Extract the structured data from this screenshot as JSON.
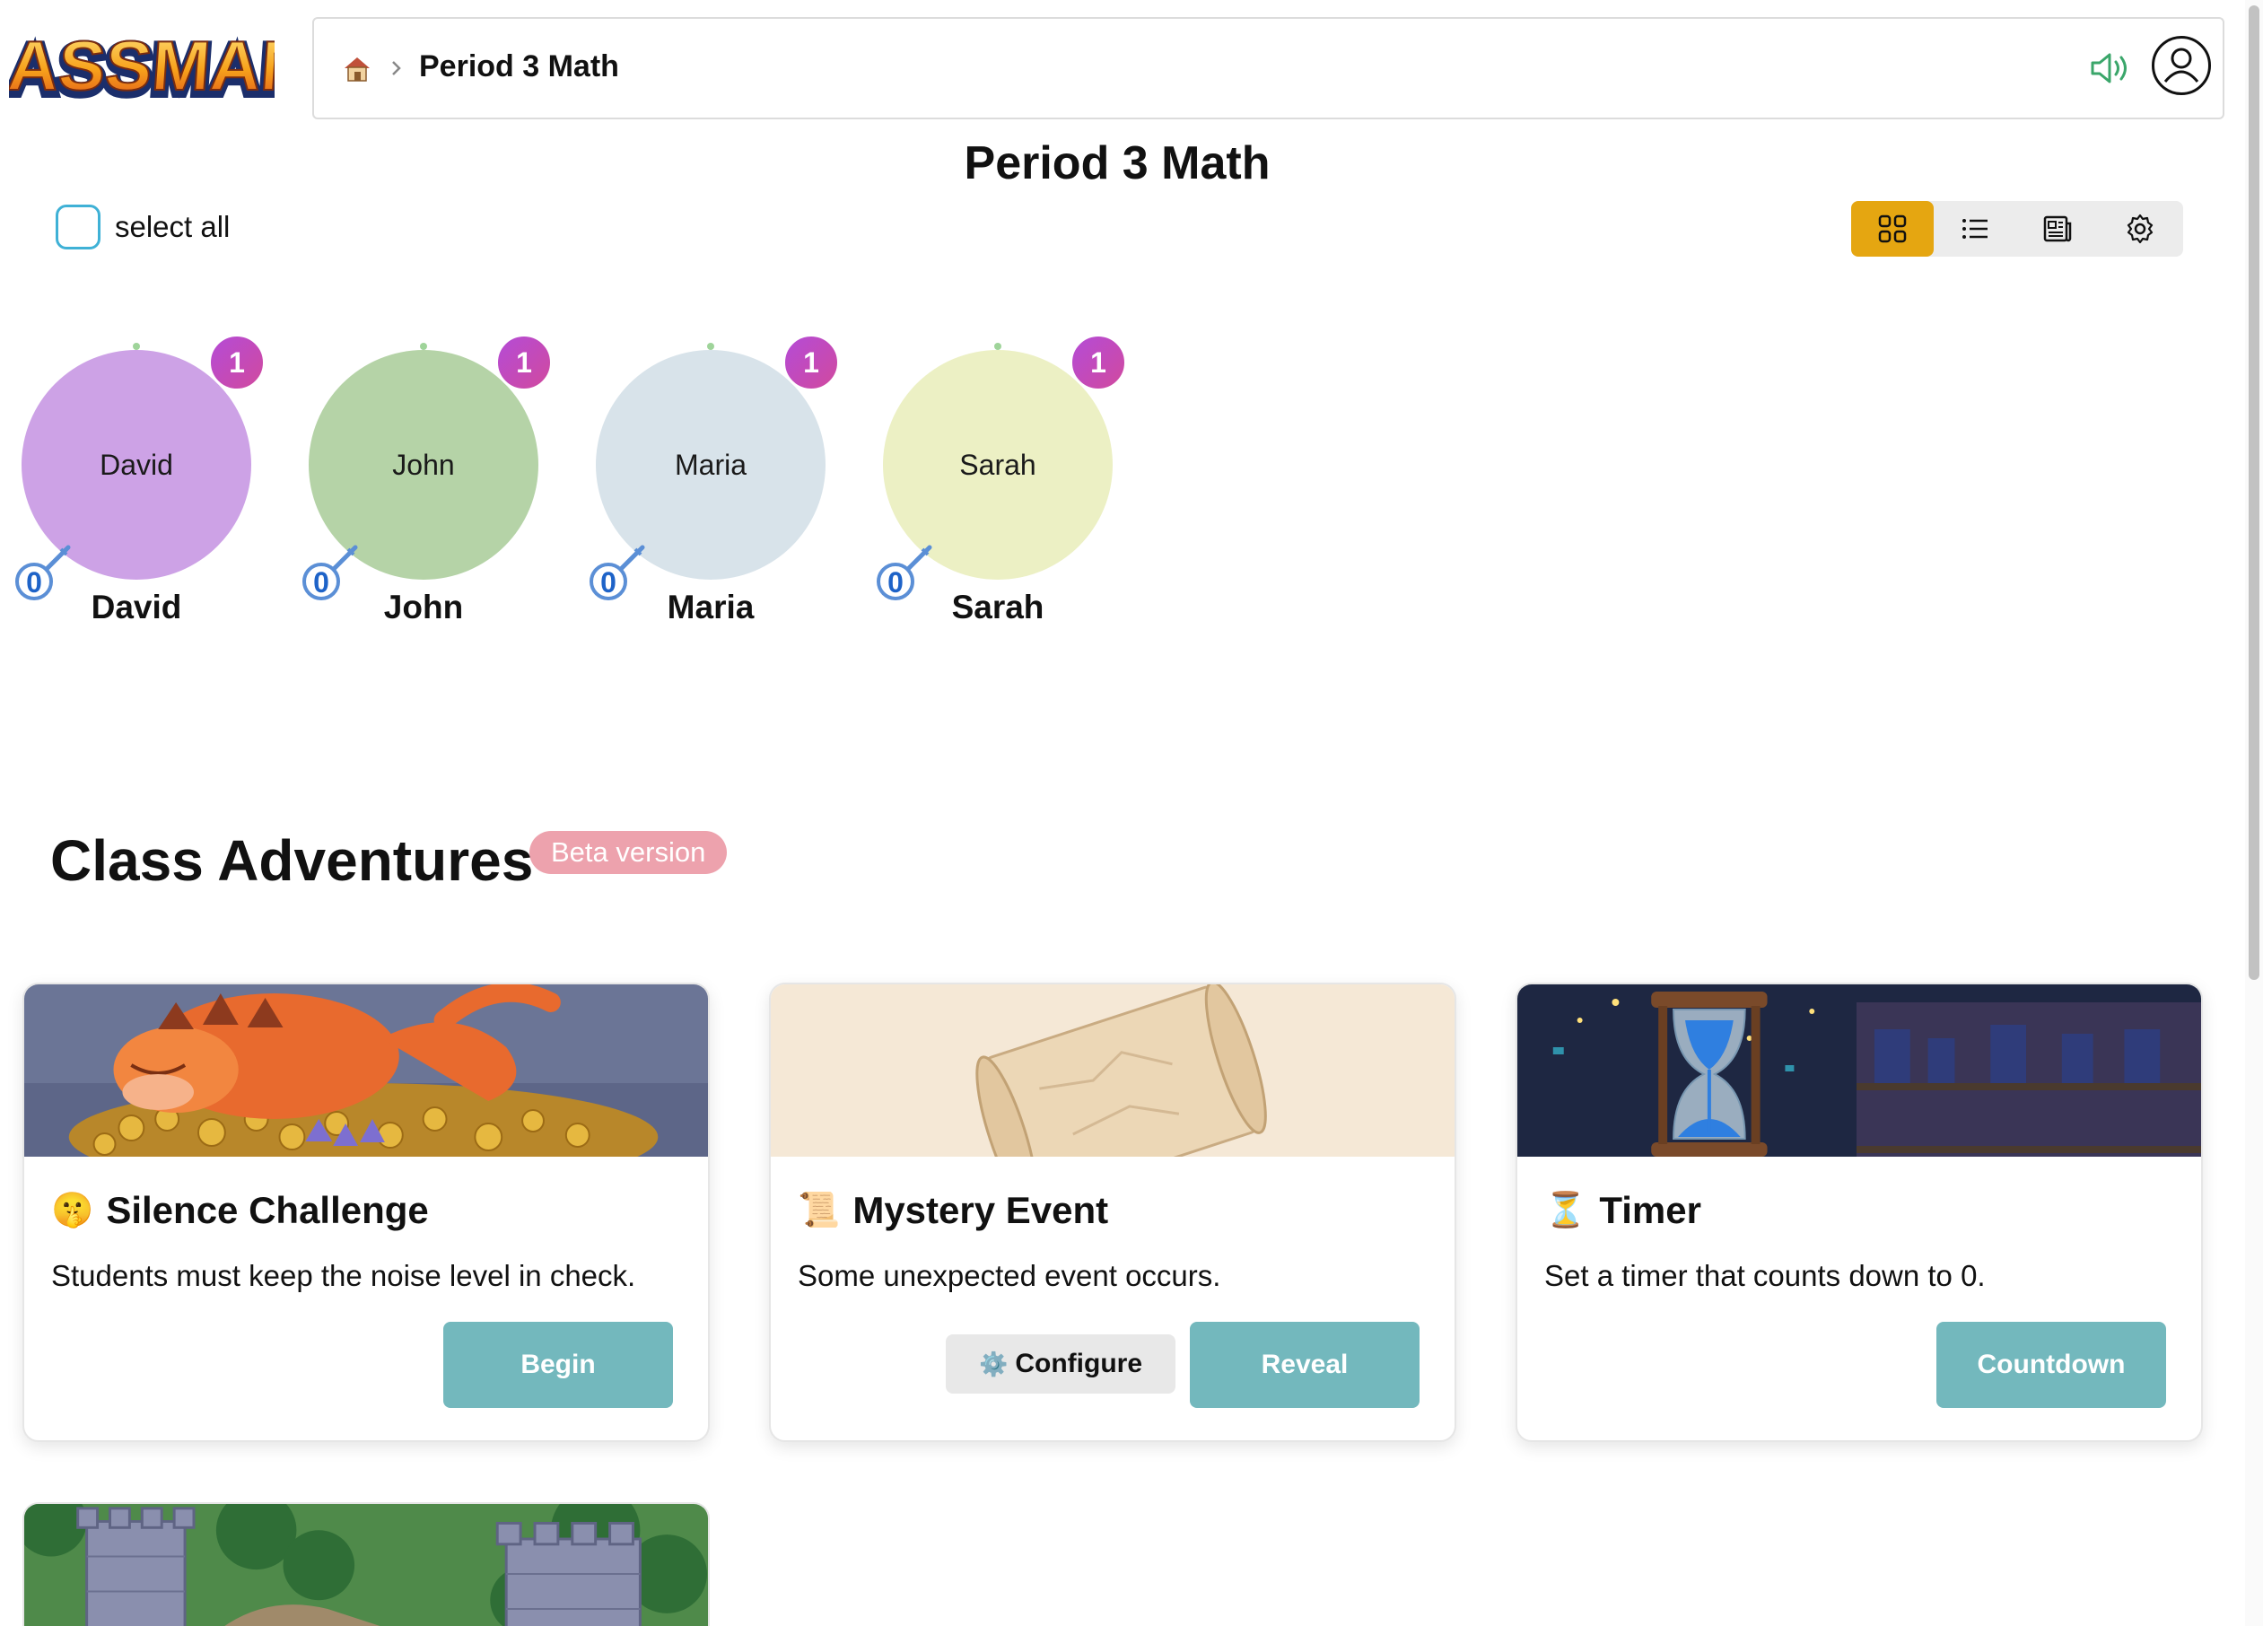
{
  "app": {
    "logo_text": "CLASSMANA"
  },
  "header": {
    "breadcrumb": {
      "home_icon": "house-icon",
      "separator_icon": "chevron-right-icon",
      "current": "Period 3 Math"
    },
    "sound_icon": "speaker-icon",
    "user_icon": "user-avatar-icon"
  },
  "page": {
    "title": "Period 3 Math"
  },
  "toolbar": {
    "select_all_label": "select all",
    "views": [
      {
        "name": "grid-view",
        "icon": "grid-icon",
        "active": true
      },
      {
        "name": "list-view",
        "icon": "list-icon",
        "active": false
      },
      {
        "name": "report-view",
        "icon": "newspaper-icon",
        "active": false
      },
      {
        "name": "settings",
        "icon": "gear-icon",
        "active": false
      }
    ],
    "active_color": "#e5a611"
  },
  "students": [
    {
      "avatar_label": "David",
      "name": "David",
      "badge": "1",
      "keys": "0",
      "color": "#cda2e6"
    },
    {
      "avatar_label": "John",
      "name": "John",
      "badge": "1",
      "keys": "0",
      "color": "#b5d3a7"
    },
    {
      "avatar_label": "Maria",
      "name": "Maria",
      "badge": "1",
      "keys": "0",
      "color": "#d8e3ea"
    },
    {
      "avatar_label": "Sarah",
      "name": "Sarah",
      "badge": "1",
      "keys": "0",
      "color": "#ecf0c4"
    }
  ],
  "adventures": {
    "title": "Class Adventures",
    "beta_label": "Beta version",
    "cards": [
      {
        "emoji": "🤫",
        "title": "Silence Challenge",
        "description": "Students must keep the noise level in check.",
        "primary_button": "Begin"
      },
      {
        "emoji": "📜",
        "title": "Mystery Event",
        "description": "Some unexpected event occurs.",
        "secondary_button": "Configure",
        "secondary_icon": "⚙️",
        "primary_button": "Reveal"
      },
      {
        "emoji": "⏳",
        "title": "Timer",
        "description": "Set a timer that counts down to 0.",
        "primary_button": "Countdown"
      }
    ],
    "button_color": "#73b8bd"
  }
}
